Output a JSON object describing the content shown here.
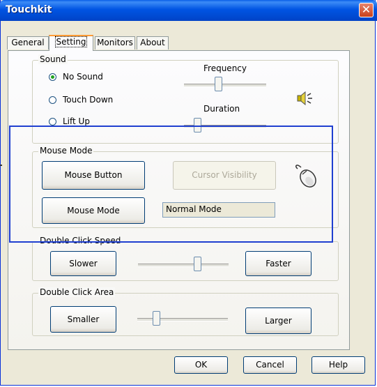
{
  "window": {
    "title": "Touchkit"
  },
  "tabs": [
    {
      "label": "General"
    },
    {
      "label": "Setting"
    },
    {
      "label": "Monitors"
    },
    {
      "label": "About"
    }
  ],
  "sound": {
    "group_label": "Sound",
    "options": [
      "No Sound",
      "Touch Down",
      "Lift Up"
    ],
    "selected": "No Sound",
    "frequency_label": "Frequency",
    "duration_label": "Duration"
  },
  "mouse_mode": {
    "group_label": "Mouse Mode",
    "mouse_button_label": "Mouse Button",
    "cursor_visibility_label": "Cursor Visibility",
    "mouse_mode_label": "Mouse Mode",
    "mode_value": "Normal Mode"
  },
  "double_click_speed": {
    "group_label": "Double Click Speed",
    "slower_label": "Slower",
    "faster_label": "Faster"
  },
  "double_click_area": {
    "group_label": "Double Click Area",
    "smaller_label": "Smaller",
    "larger_label": "Larger"
  },
  "footer": {
    "ok_label": "OK",
    "cancel_label": "Cancel",
    "help_label": "Help"
  },
  "icons": [
    "close-icon",
    "speaker-icon",
    "mouse-icon"
  ],
  "colors": {
    "titlebar": "#0054e3",
    "highlight_box": "#1f3fd0",
    "dialog_bg": "#ece9d8"
  }
}
